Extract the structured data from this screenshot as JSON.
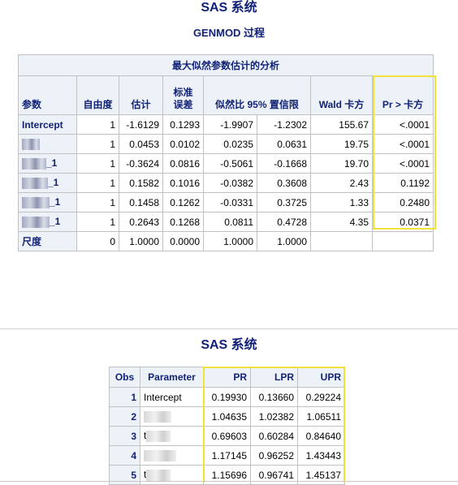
{
  "titles": {
    "main": "SAS 系统",
    "procedure": "GENMOD 过程",
    "second": "SAS 系统"
  },
  "estimates_table": {
    "caption": "最大似然参数估计的分析",
    "headers": [
      "参数",
      "自由度",
      "估计",
      "标准误差",
      "似然比 95% 置信限",
      "Wald 卡方",
      "Pr > 卡方"
    ],
    "header_labels": {
      "param": "参数",
      "df": "自由度",
      "est": "估计",
      "se_line1": "标准",
      "se_line2": "误差",
      "ci": "似然比 95% 置信限",
      "wald": "Wald 卡方",
      "pr": "Pr > 卡方"
    },
    "rows": [
      {
        "param": "Intercept",
        "suffix": "",
        "df": "1",
        "est": "-1.6129",
        "se": "0.1293",
        "lcl": "-1.9907",
        "ucl": "-1.2302",
        "wald": "155.67",
        "pr": "<.0001"
      },
      {
        "param": "",
        "suffix": "",
        "df": "1",
        "est": "0.0453",
        "se": "0.0102",
        "lcl": "0.0235",
        "ucl": "0.0631",
        "wald": "19.75",
        "pr": "<.0001"
      },
      {
        "param": "",
        "suffix": "_1",
        "df": "1",
        "est": "-0.3624",
        "se": "0.0816",
        "lcl": "-0.5061",
        "ucl": "-0.1668",
        "wald": "19.70",
        "pr": "<.0001"
      },
      {
        "param": "",
        "suffix": "_1",
        "df": "1",
        "est": "0.1582",
        "se": "0.1016",
        "lcl": "-0.0382",
        "ucl": "0.3608",
        "wald": "2.43",
        "pr": "0.1192"
      },
      {
        "param": "",
        "suffix": "_1",
        "df": "1",
        "est": "0.1458",
        "se": "0.1262",
        "lcl": "-0.0331",
        "ucl": "0.3725",
        "wald": "1.33",
        "pr": "0.2480"
      },
      {
        "param": "",
        "suffix": "_1",
        "df": "1",
        "est": "0.2643",
        "se": "0.1268",
        "lcl": "0.0811",
        "ucl": "0.4728",
        "wald": "4.35",
        "pr": "0.0371"
      },
      {
        "param": "尺度",
        "suffix": "",
        "df": "0",
        "est": "1.0000",
        "se": "0.0000",
        "lcl": "1.0000",
        "ucl": "1.0000",
        "wald": "",
        "pr": ""
      }
    ]
  },
  "or_table": {
    "headers": {
      "obs": "Obs",
      "param": "Parameter",
      "pr": "PR",
      "lpr": "LPR",
      "upr": "UPR"
    },
    "rows": [
      {
        "obs": "1",
        "param": "Intercept",
        "pr": "0.19930",
        "lpr": "0.13660",
        "upr": "0.29224"
      },
      {
        "obs": "2",
        "param": "",
        "pr": "1.04635",
        "lpr": "1.02382",
        "upr": "1.06511"
      },
      {
        "obs": "3",
        "param": "t",
        "pr": "0.69603",
        "lpr": "0.60284",
        "upr": "0.84640"
      },
      {
        "obs": "4",
        "param": "",
        "pr": "1.17145",
        "lpr": "0.96252",
        "upr": "1.43443"
      },
      {
        "obs": "5",
        "param": "t",
        "pr": "1.15696",
        "lpr": "0.96741",
        "upr": "1.45137"
      }
    ]
  },
  "highlight_color": "#f2e13a"
}
